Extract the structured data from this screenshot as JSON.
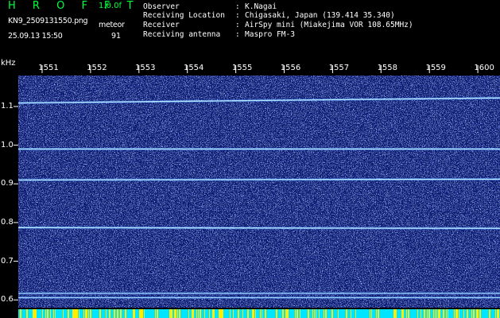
{
  "header": {
    "app_title": "H R O F F T",
    "version": "1.0.0f",
    "file_name": "KN9_2509131550.png",
    "datetime": "25.09.13 15:50",
    "mode_label": "meteor",
    "mode_value": "91"
  },
  "station": [
    {
      "key": "Observer",
      "value": "K.Nagai"
    },
    {
      "key": "Receiving Location",
      "value": "Chigasaki, Japan (139.414 35.340)"
    },
    {
      "key": "Receiver",
      "value": "AirSpy mini (Miakejima VOR 108.65MHz)"
    },
    {
      "key": "Receiving antenna",
      "value": "Maspro FM-3"
    }
  ],
  "colors": {
    "title_green": "#00ff3c",
    "background_blue": "#0b1a6e",
    "signal_line": "#b8e8ff",
    "bottom_strip_cyan": "#00e5ff",
    "bottom_strip_yellow": "#ffee00"
  },
  "chart_data": {
    "type": "heatmap",
    "title": "",
    "xlabel": "",
    "ylabel": "kHz",
    "x_ticks": [
      "1551",
      "1552",
      "1553",
      "1554",
      "1555",
      "1556",
      "1557",
      "1558",
      "1559",
      "1600"
    ],
    "y_ticks": [
      "1.1",
      "1.0",
      "0.9",
      "0.8",
      "0.7",
      "0.6"
    ],
    "xlim": [
      "15:50:00",
      "16:00:30"
    ],
    "ylim": [
      0.58,
      1.18
    ],
    "signal_lines_khz": [
      {
        "start": 1.109,
        "end": 1.122
      },
      {
        "start": 0.99,
        "end": 0.99
      },
      {
        "start": 0.91,
        "end": 0.912
      },
      {
        "start": 0.787,
        "end": 0.785
      },
      {
        "start": 0.617,
        "end": 0.617
      },
      {
        "start": 0.606,
        "end": 0.606
      }
    ]
  }
}
